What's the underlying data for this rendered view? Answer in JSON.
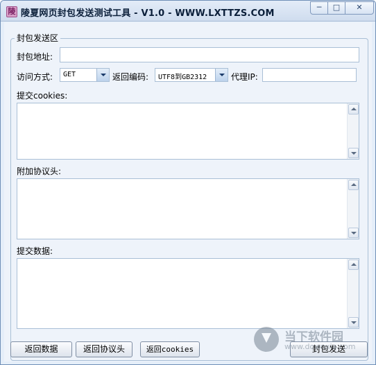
{
  "window": {
    "title": "陵夏网页封包发送测试工具 - V1.0 - WWW.LXTTZS.COM",
    "app_icon_glyph": "陵",
    "controls": {
      "minimize": "─",
      "maximize": "□",
      "close": "✕"
    }
  },
  "group": {
    "legend": "封包发送区"
  },
  "fields": {
    "address_label": "封包地址:",
    "address_value": "",
    "method_label": "访问方式:",
    "method_value": "GET",
    "encoding_label": "返回编码:",
    "encoding_value": "UTF8到GB2312",
    "proxy_label": "代理IP:",
    "proxy_value": "",
    "cookies_label": "提交cookies:",
    "headers_label": "附加协议头:",
    "postdata_label": "提交数据:"
  },
  "buttons": {
    "return_data": "返回数据",
    "return_headers": "返回协议头",
    "return_cookies": "返回cookies",
    "send": "封包发送"
  },
  "watermark": {
    "title": "当下软件园",
    "url": "www.downxia.com"
  },
  "colors": {
    "window_bg": "#eef3fa",
    "border": "#a9bfd6"
  }
}
